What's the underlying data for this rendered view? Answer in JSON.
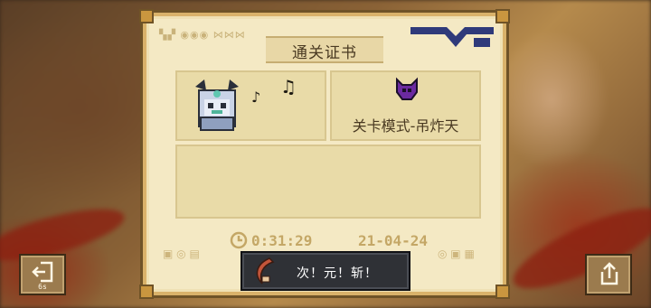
{
  "certificate": {
    "title": "通关证书",
    "mode_label": "关卡模式-吊炸天",
    "clear_time": "0:31:29",
    "clear_date": "21-04-24"
  },
  "toast": {
    "text": "次！元！斩！",
    "icon": "slash-weapon-icon"
  },
  "buttons": {
    "exit_icon": "exit-icon",
    "exit_countdown": "6s",
    "share_icon": "share-icon"
  },
  "colors": {
    "paper": "#f4e9c4",
    "frame": "#d9b26a",
    "panel": "#e9dba8",
    "text": "#4a3a22",
    "muted_text": "#c4a766",
    "toast_bg": "#2f3136"
  }
}
